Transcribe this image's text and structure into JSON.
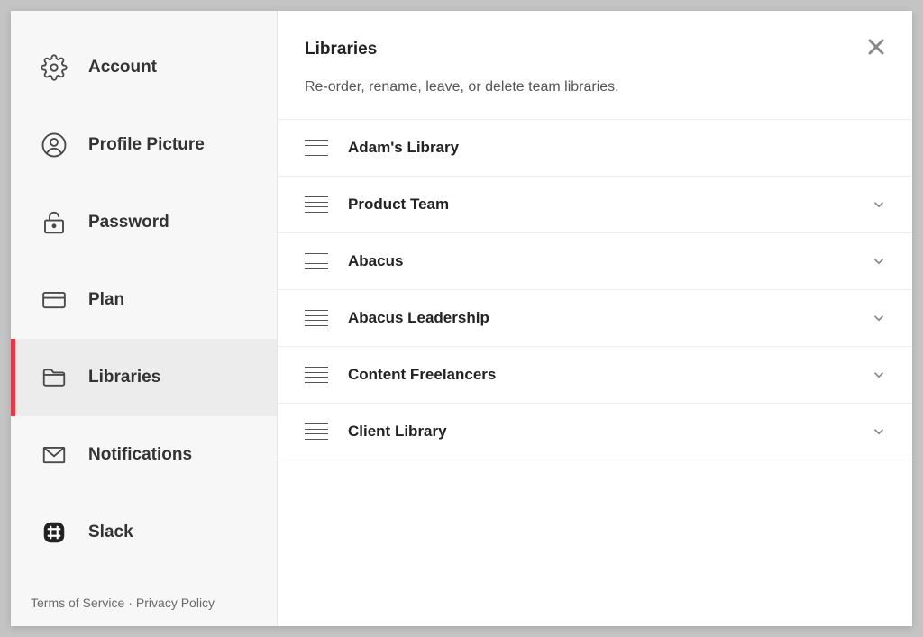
{
  "sidebar": {
    "items": [
      {
        "label": "Account",
        "icon": "gear"
      },
      {
        "label": "Profile Picture",
        "icon": "profile"
      },
      {
        "label": "Password",
        "icon": "lock"
      },
      {
        "label": "Plan",
        "icon": "card"
      },
      {
        "label": "Libraries",
        "icon": "folder",
        "active": true
      },
      {
        "label": "Notifications",
        "icon": "mail"
      },
      {
        "label": "Slack",
        "icon": "slack"
      }
    ],
    "footer": {
      "terms": "Terms of Service",
      "privacy": "Privacy Policy"
    }
  },
  "main": {
    "title": "Libraries",
    "subtitle": "Re-order, rename, leave, or delete team libraries.",
    "libraries": [
      {
        "name": "Adam's Library",
        "expandable": false
      },
      {
        "name": "Product Team",
        "expandable": true
      },
      {
        "name": "Abacus",
        "expandable": true
      },
      {
        "name": "Abacus Leadership",
        "expandable": true
      },
      {
        "name": "Content Freelancers",
        "expandable": true
      },
      {
        "name": "Client Library",
        "expandable": true
      }
    ]
  }
}
